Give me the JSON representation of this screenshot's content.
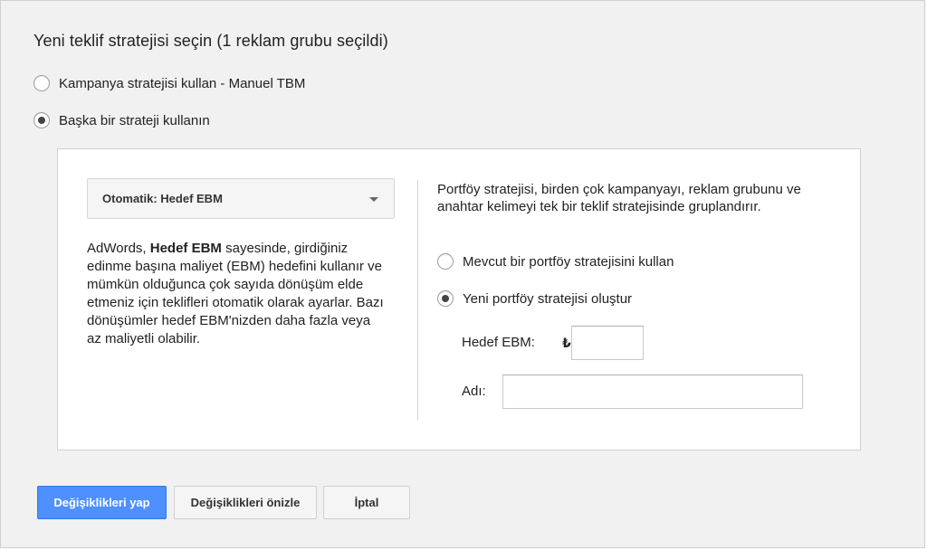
{
  "dialog": {
    "title": "Yeni teklif stratejisi seçin (1 reklam grubu seçildi)"
  },
  "strategy_options": [
    {
      "label": "Kampanya stratejisi kullan - Manuel TBM",
      "selected": false
    },
    {
      "label": "Başka bir strateji kullanın",
      "selected": true
    }
  ],
  "panel": {
    "strategy_select": {
      "value": "Otomatik: Hedef EBM",
      "icon": "chevron-down-icon"
    },
    "description": {
      "prefix": "AdWords, ",
      "bold": "Hedef EBM",
      "suffix": " sayesinde, girdiğiniz edinme başına maliyet (EBM) hedefini kullanır ve mümkün olduğunca çok sayıda dönüşüm elde etmeniz için teklifleri otomatik olarak ayarlar. Bazı dönüşümler hedef EBM'nizden daha fazla veya az maliyetli olabilir."
    },
    "portfolio_description": "Portföy stratejisi, birden çok kampanyayı, reklam grubunu ve anahtar kelimeyi tek bir teklif stratejisinde gruplandırır.",
    "portfolio_options": [
      {
        "label": "Mevcut bir portföy stratejisini kullan",
        "selected": false
      },
      {
        "label": "Yeni portföy stratejisi oluştur",
        "selected": true
      }
    ],
    "target_cpa": {
      "label": "Hedef EBM:",
      "currency": "₺",
      "value": ""
    },
    "name": {
      "label": "Adı:",
      "value": ""
    }
  },
  "buttons": {
    "apply": "Değişiklikleri yap",
    "preview": "Değişiklikleri önizle",
    "cancel": "İptal"
  },
  "colors": {
    "primary_button": "#4d90fe",
    "dialog_background": "#f1f1f1",
    "panel_background": "#ffffff"
  }
}
